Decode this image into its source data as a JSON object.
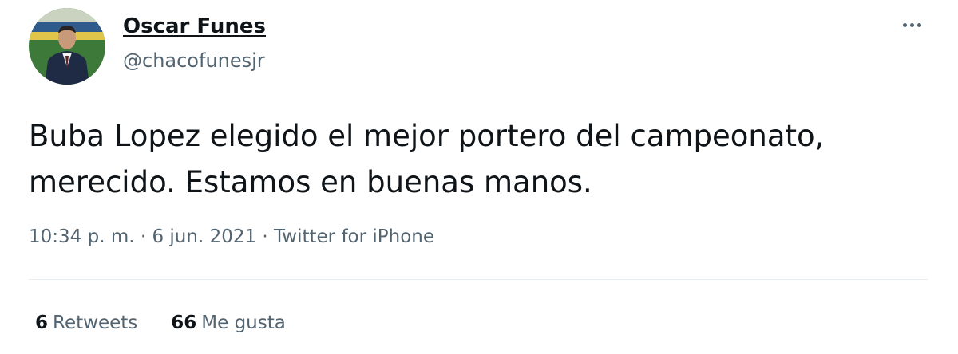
{
  "author": {
    "name": "Oscar Funes",
    "handle": "@chacofunesjr"
  },
  "tweet": {
    "lines": [
      "Buba Lopez elegido el mejor portero del campeonato,",
      "merecido. Estamos en buenas manos."
    ],
    "timestamp": "10:34 p. m. · 6 jun. 2021 · Twitter for iPhone"
  },
  "stats": {
    "retweets_count": "6",
    "retweets_label": "Retweets",
    "likes_count": "66",
    "likes_label": "Me gusta"
  },
  "icons": {
    "more": "more-options-icon"
  },
  "colors": {
    "text_primary": "#0f1419",
    "text_secondary": "#536471",
    "divider": "#e6ecf0"
  }
}
